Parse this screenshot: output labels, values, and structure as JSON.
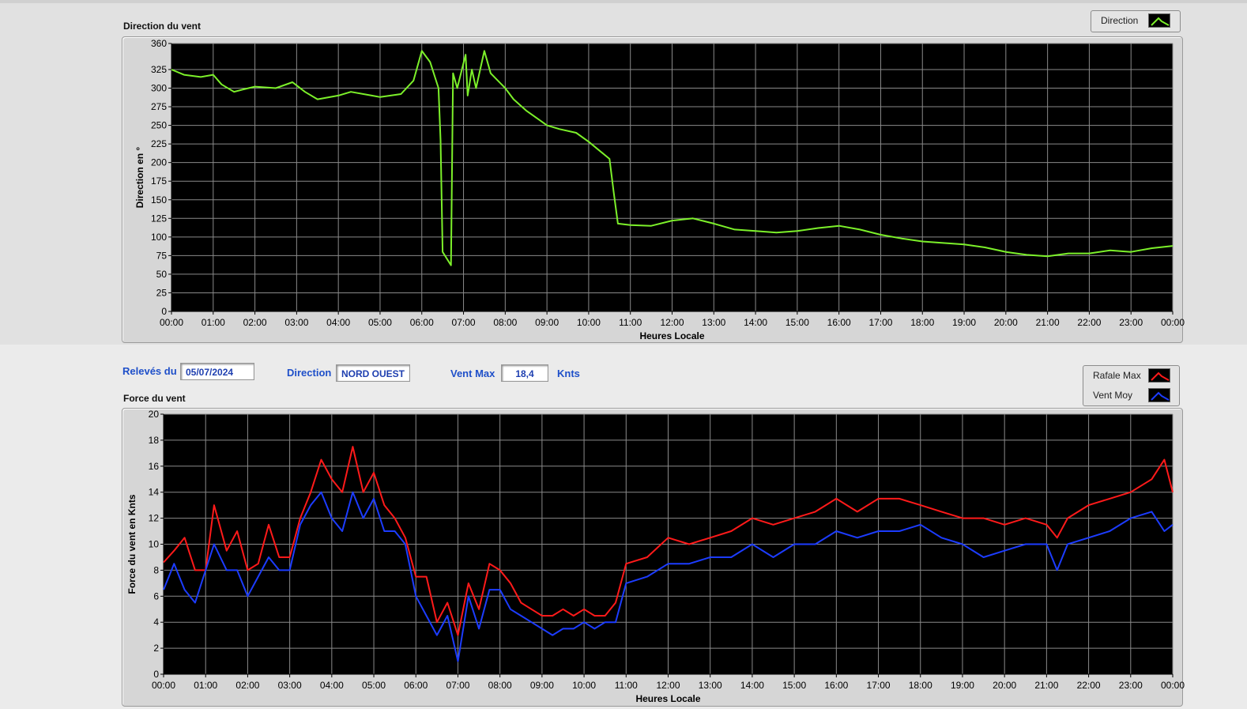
{
  "colors": {
    "direction": "#7cf02a",
    "gust": "#ff1a1a",
    "avg": "#1c3cff",
    "plot_bg": "#000000",
    "grid": "#8a8a8a",
    "label_blue": "#1e4fc9"
  },
  "info": {
    "date_label": "Relevés du",
    "date_value": "05/07/2024",
    "direction_label": "Direction",
    "direction_value": "NORD OUEST",
    "max_label": "Vent Max",
    "max_value": "18,4",
    "unit": "Knts"
  },
  "chart_data": [
    {
      "type": "line",
      "title": "Direction du vent",
      "xlabel": "Heures Locale",
      "ylabel": "Direction en °",
      "xlim": [
        0,
        24
      ],
      "ylim": [
        0,
        360
      ],
      "xticks": [
        "00:00",
        "01:00",
        "02:00",
        "03:00",
        "04:00",
        "05:00",
        "06:00",
        "07:00",
        "08:00",
        "09:00",
        "10:00",
        "11:00",
        "12:00",
        "13:00",
        "14:00",
        "15:00",
        "16:00",
        "17:00",
        "18:00",
        "19:00",
        "20:00",
        "21:00",
        "22:00",
        "23:00",
        "00:00"
      ],
      "yticks": [
        0,
        25,
        50,
        75,
        100,
        125,
        150,
        175,
        200,
        225,
        250,
        275,
        300,
        325,
        360
      ],
      "grid": true,
      "legend": "top-right",
      "series": [
        {
          "name": "Direction",
          "x": [
            0,
            0.3,
            0.7,
            1.0,
            1.2,
            1.5,
            1.7,
            2.0,
            2.5,
            2.9,
            3.2,
            3.5,
            4.0,
            4.3,
            4.8,
            5.0,
            5.5,
            5.8,
            6.0,
            6.2,
            6.4,
            6.45,
            6.5,
            6.7,
            6.75,
            6.85,
            7.05,
            7.1,
            7.2,
            7.3,
            7.5,
            7.65,
            8.0,
            8.2,
            8.5,
            8.8,
            9.0,
            9.3,
            9.7,
            10.0,
            10.5,
            10.6,
            10.7,
            11.0,
            11.5,
            12.0,
            12.5,
            13.0,
            13.5,
            14.0,
            14.5,
            15.0,
            15.5,
            16.0,
            16.5,
            17.0,
            17.5,
            18.0,
            18.5,
            19.0,
            19.5,
            20.0,
            20.5,
            21.0,
            21.5,
            22.0,
            22.5,
            23.0,
            23.5,
            24.0
          ],
          "y": [
            325,
            318,
            315,
            318,
            305,
            295,
            298,
            302,
            300,
            308,
            295,
            285,
            290,
            295,
            290,
            288,
            292,
            310,
            350,
            335,
            300,
            230,
            80,
            62,
            320,
            300,
            345,
            290,
            325,
            300,
            350,
            320,
            300,
            285,
            270,
            258,
            250,
            245,
            240,
            228,
            205,
            160,
            118,
            116,
            115,
            122,
            125,
            118,
            110,
            108,
            106,
            108,
            112,
            115,
            110,
            103,
            98,
            94,
            92,
            90,
            86,
            80,
            76,
            74,
            78,
            78,
            82,
            80,
            85,
            88
          ]
        }
      ]
    },
    {
      "type": "line",
      "title": "Force du vent",
      "xlabel": "Heures Locale",
      "ylabel": "Force du vent en Knts",
      "xlim": [
        0,
        24
      ],
      "ylim": [
        0,
        20
      ],
      "xticks": [
        "00:00",
        "01:00",
        "02:00",
        "03:00",
        "04:00",
        "05:00",
        "06:00",
        "07:00",
        "08:00",
        "09:00",
        "10:00",
        "11:00",
        "12:00",
        "13:00",
        "14:00",
        "15:00",
        "16:00",
        "17:00",
        "18:00",
        "19:00",
        "20:00",
        "21:00",
        "22:00",
        "23:00",
        "00:00"
      ],
      "yticks": [
        0,
        2,
        4,
        6,
        8,
        10,
        12,
        14,
        16,
        18,
        20
      ],
      "grid": true,
      "legend": "top-right",
      "x": [
        0,
        0.25,
        0.5,
        0.75,
        1.0,
        1.2,
        1.5,
        1.75,
        2.0,
        2.25,
        2.5,
        2.75,
        3.0,
        3.25,
        3.5,
        3.75,
        4.0,
        4.25,
        4.5,
        4.75,
        5.0,
        5.25,
        5.5,
        5.75,
        6.0,
        6.25,
        6.5,
        6.75,
        7.0,
        7.25,
        7.5,
        7.75,
        8.0,
        8.25,
        8.5,
        8.75,
        9.0,
        9.25,
        9.5,
        9.75,
        10.0,
        10.25,
        10.5,
        10.75,
        11.0,
        11.5,
        12.0,
        12.5,
        13.0,
        13.5,
        14.0,
        14.5,
        15.0,
        15.5,
        16.0,
        16.5,
        17.0,
        17.5,
        18.0,
        18.5,
        19.0,
        19.5,
        20.0,
        20.5,
        21.0,
        21.25,
        21.5,
        22.0,
        22.5,
        23.0,
        23.5,
        23.8,
        24.0
      ],
      "series": [
        {
          "name": "Rafale Max",
          "values": [
            8.6,
            9.5,
            10.5,
            8.0,
            8.0,
            13.0,
            9.5,
            11.0,
            8.0,
            8.5,
            11.5,
            9.0,
            9.0,
            12.0,
            14.0,
            16.5,
            15.0,
            14.0,
            17.5,
            14.0,
            15.5,
            13.0,
            12.0,
            10.5,
            7.5,
            7.5,
            4.0,
            5.5,
            3.0,
            7.0,
            5.0,
            8.5,
            8.0,
            7.0,
            5.5,
            5.0,
            4.5,
            4.5,
            5.0,
            4.5,
            5.0,
            4.5,
            4.5,
            5.5,
            8.5,
            9.0,
            10.5,
            10.0,
            10.5,
            11.0,
            12.0,
            11.5,
            12.0,
            12.5,
            13.5,
            12.5,
            13.5,
            13.5,
            13.0,
            12.5,
            12.0,
            12.0,
            11.5,
            12.0,
            11.5,
            10.5,
            12.0,
            13.0,
            13.5,
            14.0,
            15.0,
            16.5,
            14.0
          ]
        },
        {
          "name": "Vent Moy",
          "values": [
            6.5,
            8.5,
            6.5,
            5.5,
            8.0,
            10.0,
            8.0,
            8.0,
            6.0,
            7.5,
            9.0,
            8.0,
            8.0,
            11.5,
            13.0,
            14.0,
            12.0,
            11.0,
            14.0,
            12.0,
            13.5,
            11.0,
            11.0,
            10.0,
            6.0,
            4.5,
            3.0,
            4.5,
            1.0,
            6.0,
            3.5,
            6.5,
            6.5,
            5.0,
            4.5,
            4.0,
            3.5,
            3.0,
            3.5,
            3.5,
            4.0,
            3.5,
            4.0,
            4.0,
            7.0,
            7.5,
            8.5,
            8.5,
            9.0,
            9.0,
            10.0,
            9.0,
            10.0,
            10.0,
            11.0,
            10.5,
            11.0,
            11.0,
            11.5,
            10.5,
            10.0,
            9.0,
            9.5,
            10.0,
            10.0,
            8.0,
            10.0,
            10.5,
            11.0,
            12.0,
            12.5,
            11.0,
            11.5
          ]
        }
      ]
    }
  ]
}
